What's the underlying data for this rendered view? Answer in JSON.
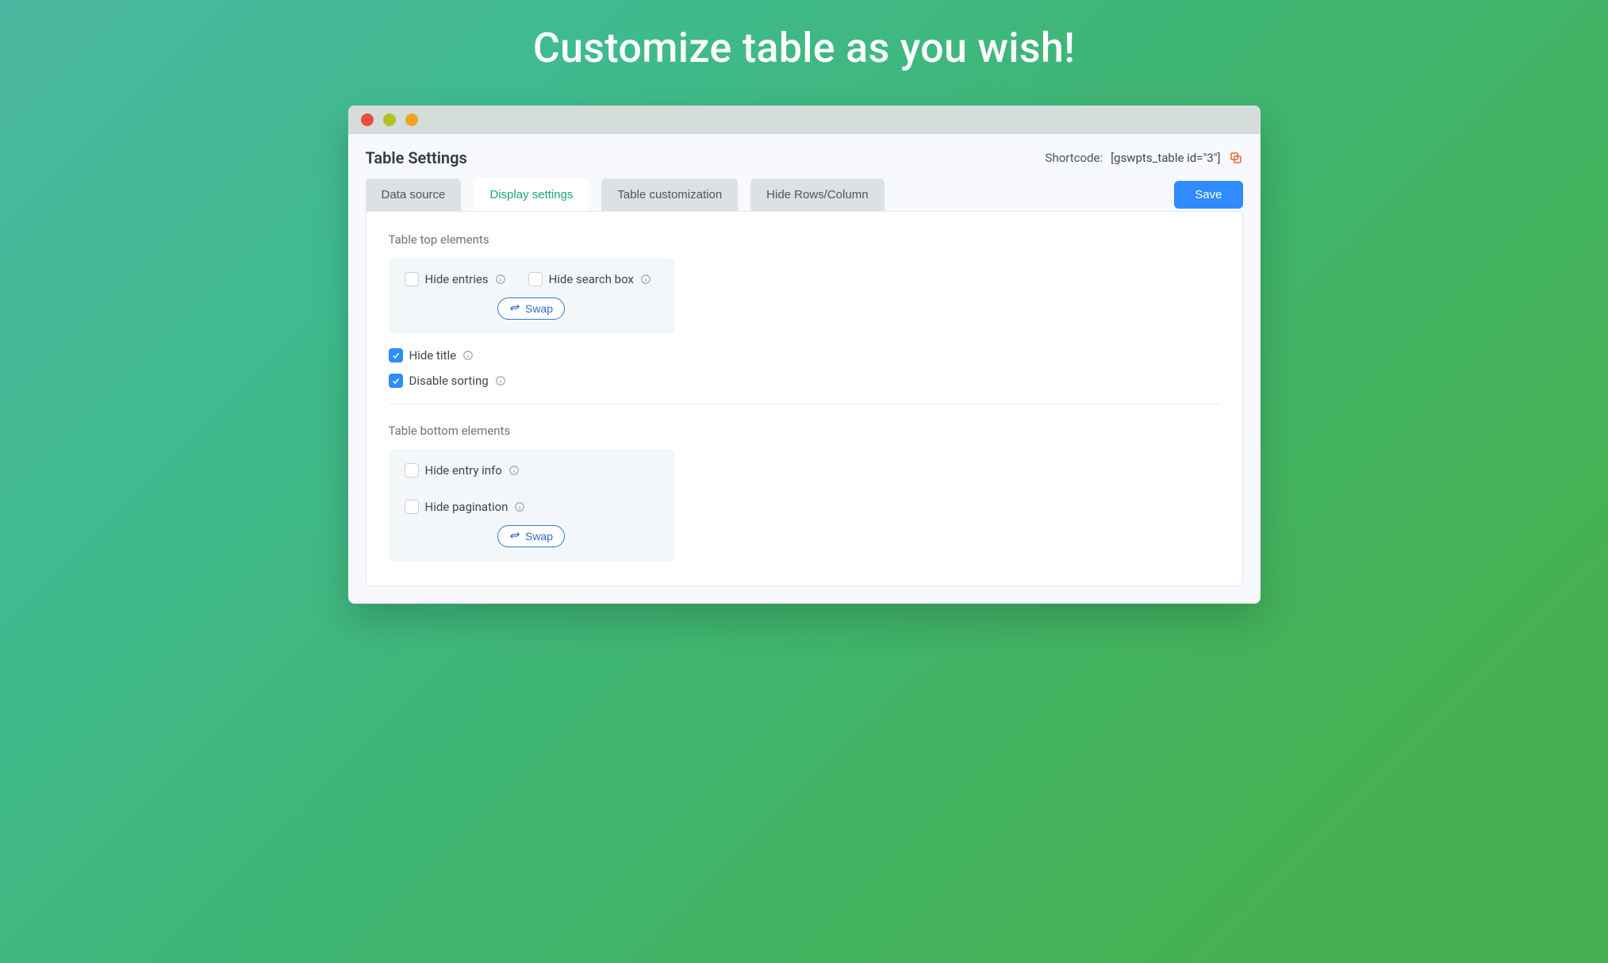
{
  "headline": "Customize table as you wish!",
  "header": {
    "title": "Table Settings",
    "shortcode_label": "Shortcode:",
    "shortcode_value": "[gswpts_table id=\"3\"]"
  },
  "tabs": [
    {
      "key": "data-source",
      "label": "Data source",
      "active": false
    },
    {
      "key": "display-settings",
      "label": "Display settings",
      "active": true
    },
    {
      "key": "table-customization",
      "label": "Table customization",
      "active": false
    },
    {
      "key": "hide-rows-column",
      "label": "Hide Rows/Column",
      "active": false
    }
  ],
  "save_label": "Save",
  "swap_label": "Swap",
  "sections": {
    "top": {
      "title": "Table top elements",
      "checks": [
        {
          "key": "hide-entries",
          "label": "Hide entries",
          "checked": false
        },
        {
          "key": "hide-search-box",
          "label": "Hide search box",
          "checked": false
        }
      ]
    },
    "standalone": [
      {
        "key": "hide-title",
        "label": "Hide title",
        "checked": true
      },
      {
        "key": "disable-sorting",
        "label": "Disable sorting",
        "checked": true
      }
    ],
    "bottom": {
      "title": "Table bottom elements",
      "checks": [
        {
          "key": "hide-entry-info",
          "label": "Hide entry info",
          "checked": false
        },
        {
          "key": "hide-pagination",
          "label": "Hide pagination",
          "checked": false
        }
      ]
    }
  }
}
